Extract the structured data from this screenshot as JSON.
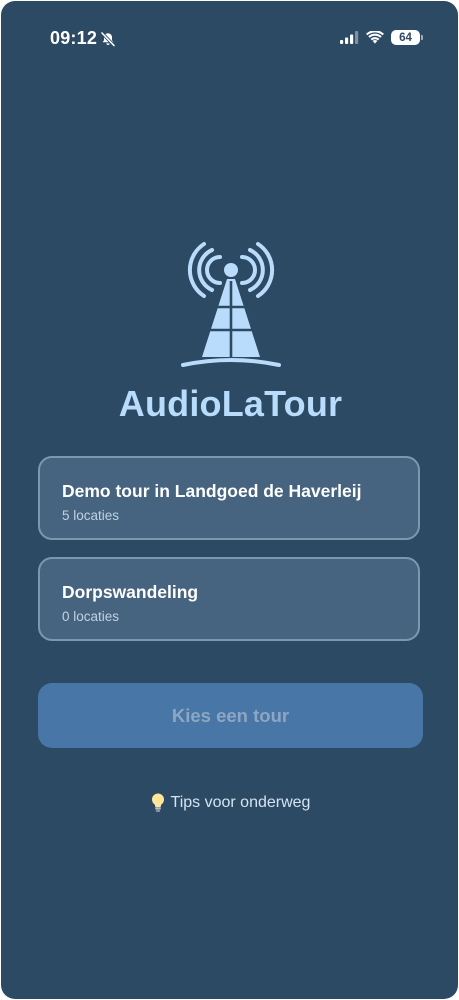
{
  "status_bar": {
    "time": "09:12",
    "battery_level": "64",
    "icons": [
      "bell-slash-icon",
      "signal-icon",
      "wifi-icon",
      "battery-icon"
    ]
  },
  "app": {
    "title": "AudioLaTour",
    "logo_icon": "radio-tower-icon"
  },
  "tours": [
    {
      "name": "Demo tour in Landgoed de Haverleij",
      "count": "5 locaties"
    },
    {
      "name": "Dorpswandeling",
      "count": "0 locaties"
    }
  ],
  "actions": {
    "choose_tour_label": "Kies een tour",
    "tips_label": "Tips voor onderweg",
    "tips_icon": "lightbulb-icon"
  },
  "colors": {
    "background": "#2c4a64",
    "card": "#466380",
    "card_border": "#7d97b1",
    "accent": "#b9dcfc",
    "button": "#4876a6",
    "button_text_disabled": "#8da6c1"
  }
}
